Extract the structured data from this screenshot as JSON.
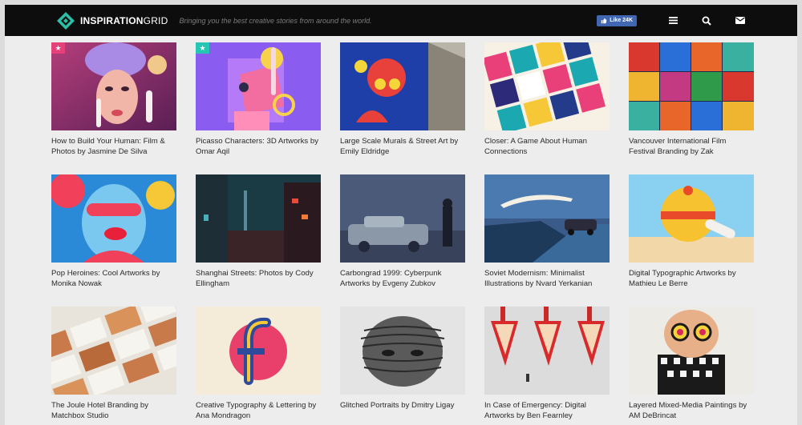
{
  "header": {
    "logo_bold": "INSPIRATION",
    "logo_light": "GRID",
    "tagline": "Bringing you the best creative stories from around the world.",
    "like_label": "Like 24K",
    "icons": [
      "menu-icon",
      "search-icon",
      "mail-icon"
    ]
  },
  "colors": {
    "header_bg": "#0d0d0d",
    "page_bg": "#ededee",
    "facebook": "#4267b2",
    "badge_pink": "#e6407a",
    "badge_teal": "#26c6b4"
  },
  "cards": [
    {
      "title": "How to Build Your Human: Film & Photos by",
      "author": "Jasmine De Silva",
      "badge": "pink-star"
    },
    {
      "title": "Picasso Characters: 3D Artworks",
      "author": "by Omar Aqil",
      "badge": "teal-star"
    },
    {
      "title": "Large Scale Murals & Street Art",
      "author": "by Emily Eldridge"
    },
    {
      "title": "Closer: A Game About Human",
      "author": "Connections"
    },
    {
      "title": "Vancouver International Film",
      "author": "Festival Branding by Zak"
    },
    {
      "title": "Pop Heroines: Cool Artworks by",
      "author": "Monika Nowak"
    },
    {
      "title": "Shanghai Streets: Photos by",
      "author": "Cody Ellingham"
    },
    {
      "title": "Carbongrad 1999: Cyberpunk",
      "author": "Artworks by Evgeny Zubkov"
    },
    {
      "title": "Soviet Modernism: Minimalist",
      "author": "Illustrations by Nvard Yerkanian"
    },
    {
      "title": "Digital Typographic Artworks by",
      "author": "Mathieu Le Berre"
    },
    {
      "title": "The Joule Hotel Branding by",
      "author": "Matchbox Studio"
    },
    {
      "title": "Creative Typography & Lettering",
      "author": "by Ana Mondragon"
    },
    {
      "title": "Glitched Portraits by Dmitry",
      "author": "Ligay"
    },
    {
      "title": "In Case of Emergency: Digital",
      "author": "Artworks by Ben Fearnley"
    },
    {
      "title": "Layered Mixed-Media Paintings",
      "author": "by AM DeBrincat"
    }
  ]
}
